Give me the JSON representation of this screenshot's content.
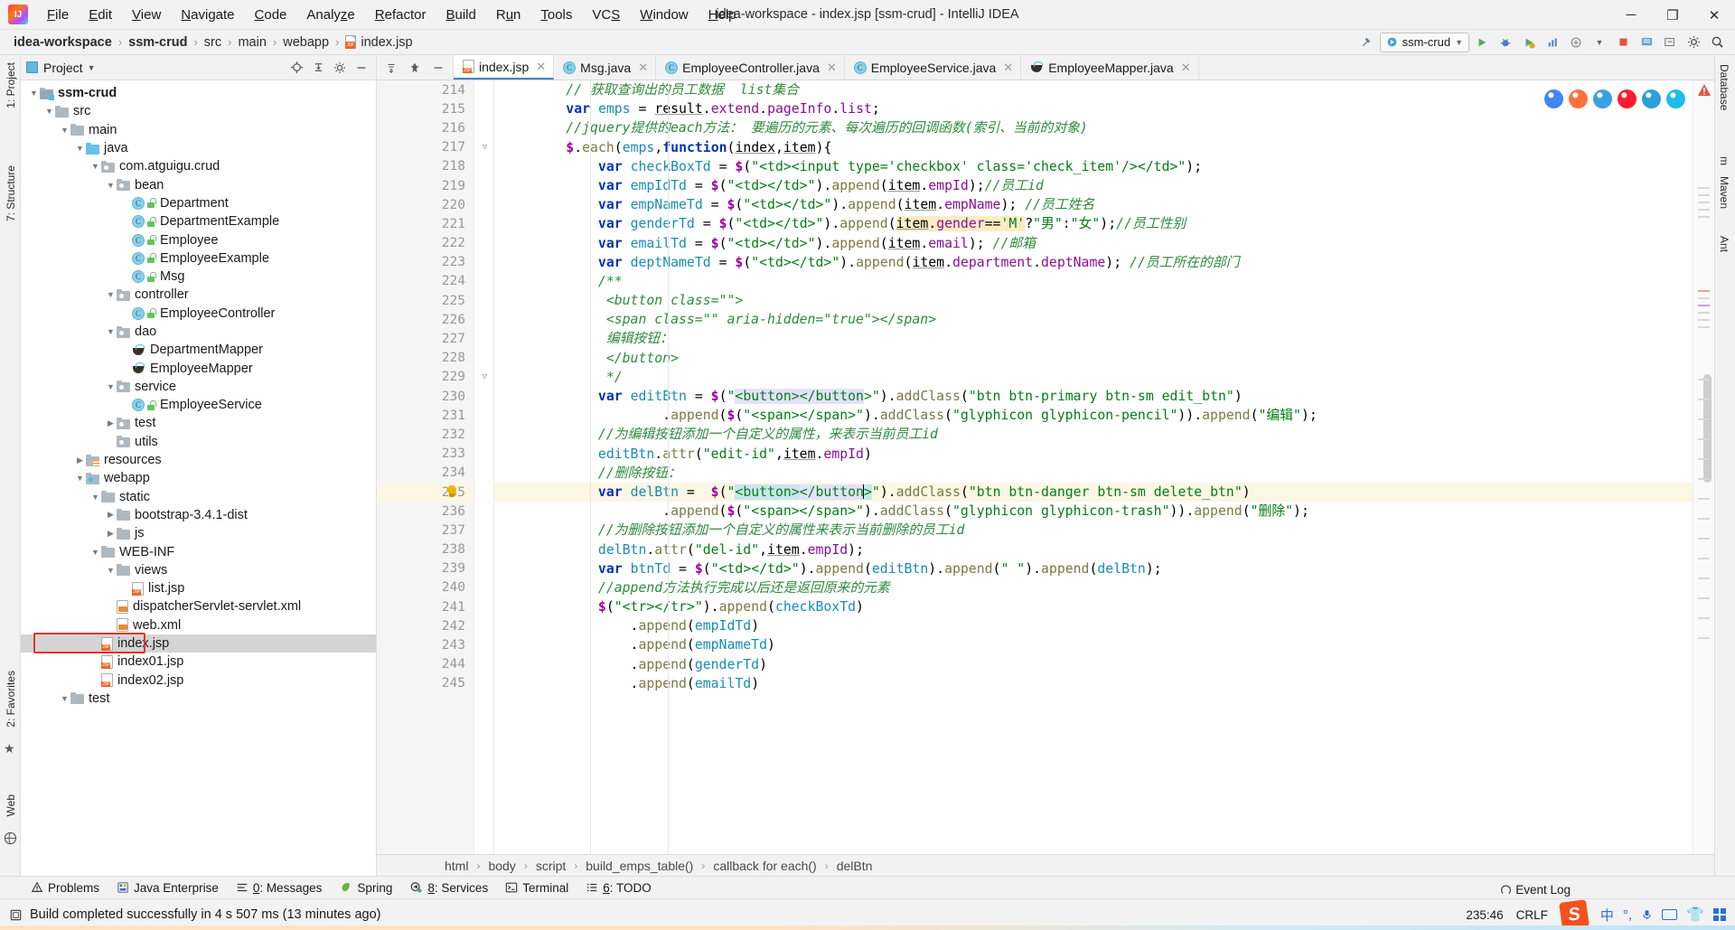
{
  "window": {
    "title": "idea-workspace - index.jsp [ssm-crud] - IntelliJ IDEA",
    "minimize": "─",
    "maximize": "❐",
    "close": "✕"
  },
  "menubar": [
    {
      "label": "File",
      "mnemonic": "F"
    },
    {
      "label": "Edit",
      "mnemonic": "E"
    },
    {
      "label": "View",
      "mnemonic": "V"
    },
    {
      "label": "Navigate",
      "mnemonic": "N"
    },
    {
      "label": "Code",
      "mnemonic": "C"
    },
    {
      "label": "Analyze",
      "mnemonic": "z"
    },
    {
      "label": "Refactor",
      "mnemonic": "R"
    },
    {
      "label": "Build",
      "mnemonic": "B"
    },
    {
      "label": "Run",
      "mnemonic": "u"
    },
    {
      "label": "Tools",
      "mnemonic": "T"
    },
    {
      "label": "VCS",
      "mnemonic": "S"
    },
    {
      "label": "Window",
      "mnemonic": "W"
    },
    {
      "label": "Help",
      "mnemonic": "H"
    }
  ],
  "breadcrumb": [
    {
      "label": "idea-workspace",
      "bold": true
    },
    {
      "label": "ssm-crud",
      "bold": true
    },
    {
      "label": "src",
      "bold": false
    },
    {
      "label": "main",
      "bold": false
    },
    {
      "label": "webapp",
      "bold": false
    },
    {
      "label": "index.jsp",
      "bold": false,
      "icon": "jsp-file-icon"
    }
  ],
  "nav_right": {
    "build_icon": "hammer-icon",
    "run_config": "ssm-crud",
    "run_icon": "run-icon",
    "debug_icon": "debug-icon",
    "coverage_icon": "coverage-icon",
    "profile_icon": "profile-icon",
    "attach_icon": "attach-icon",
    "stop_icon": "stop-icon",
    "update_icon": "update-icon",
    "settings_icon": "gear-icon",
    "search_icon": "search-icon"
  },
  "left_strips": [
    {
      "label": "1: Project"
    },
    {
      "label": "7: Structure"
    },
    {
      "label": "2: Favorites"
    },
    {
      "label": "Web"
    }
  ],
  "right_strips": [
    {
      "label": "Database"
    },
    {
      "label": "m"
    },
    {
      "label": "Maven"
    },
    {
      "label": "Ant"
    }
  ],
  "project_panel": {
    "title": "Project",
    "chevron": "▼",
    "tools": [
      "target-icon",
      "collapse-icon",
      "gear-icon",
      "hide-icon"
    ],
    "tree": [
      {
        "depth": 0,
        "label": "ssm-crud",
        "arrow": "down",
        "icon": "module-folder",
        "bold": true
      },
      {
        "depth": 1,
        "label": "src",
        "arrow": "down",
        "icon": "folder"
      },
      {
        "depth": 2,
        "label": "main",
        "arrow": "down",
        "icon": "folder"
      },
      {
        "depth": 3,
        "label": "java",
        "arrow": "down",
        "icon": "source-folder"
      },
      {
        "depth": 4,
        "label": "com.atguigu.crud",
        "arrow": "down",
        "icon": "package-folder"
      },
      {
        "depth": 5,
        "label": "bean",
        "arrow": "down",
        "icon": "package-folder"
      },
      {
        "depth": 6,
        "label": "Department",
        "arrow": "none",
        "icon": "java-class"
      },
      {
        "depth": 6,
        "label": "DepartmentExample",
        "arrow": "none",
        "icon": "java-class"
      },
      {
        "depth": 6,
        "label": "Employee",
        "arrow": "none",
        "icon": "java-class"
      },
      {
        "depth": 6,
        "label": "EmployeeExample",
        "arrow": "none",
        "icon": "java-class"
      },
      {
        "depth": 6,
        "label": "Msg",
        "arrow": "none",
        "icon": "java-class"
      },
      {
        "depth": 5,
        "label": "controller",
        "arrow": "down",
        "icon": "package-folder"
      },
      {
        "depth": 6,
        "label": "EmployeeController",
        "arrow": "none",
        "icon": "java-class"
      },
      {
        "depth": 5,
        "label": "dao",
        "arrow": "down",
        "icon": "package-folder"
      },
      {
        "depth": 6,
        "label": "DepartmentMapper",
        "arrow": "none",
        "icon": "mybatis-mapper"
      },
      {
        "depth": 6,
        "label": "EmployeeMapper",
        "arrow": "none",
        "icon": "mybatis-mapper"
      },
      {
        "depth": 5,
        "label": "service",
        "arrow": "down",
        "icon": "package-folder"
      },
      {
        "depth": 6,
        "label": "EmployeeService",
        "arrow": "none",
        "icon": "java-class"
      },
      {
        "depth": 5,
        "label": "test",
        "arrow": "right",
        "icon": "package-folder"
      },
      {
        "depth": 5,
        "label": "utils",
        "arrow": "none",
        "icon": "package-folder"
      },
      {
        "depth": 3,
        "label": "resources",
        "arrow": "right",
        "icon": "resources-folder"
      },
      {
        "depth": 3,
        "label": "webapp",
        "arrow": "down",
        "icon": "webapp-folder"
      },
      {
        "depth": 4,
        "label": "static",
        "arrow": "down",
        "icon": "folder"
      },
      {
        "depth": 5,
        "label": "bootstrap-3.4.1-dist",
        "arrow": "right",
        "icon": "folder"
      },
      {
        "depth": 5,
        "label": "js",
        "arrow": "right",
        "icon": "folder"
      },
      {
        "depth": 4,
        "label": "WEB-INF",
        "arrow": "down",
        "icon": "folder"
      },
      {
        "depth": 5,
        "label": "views",
        "arrow": "down",
        "icon": "folder"
      },
      {
        "depth": 6,
        "label": "list.jsp",
        "arrow": "none",
        "icon": "jsp-file"
      },
      {
        "depth": 5,
        "label": "dispatcherServlet-servlet.xml",
        "arrow": "none",
        "icon": "xml-file"
      },
      {
        "depth": 5,
        "label": "web.xml",
        "arrow": "none",
        "icon": "xml-file"
      },
      {
        "depth": 4,
        "label": "index.jsp",
        "arrow": "none",
        "icon": "jsp-file",
        "selected": true,
        "annotated": true
      },
      {
        "depth": 4,
        "label": "index01.jsp",
        "arrow": "none",
        "icon": "jsp-file"
      },
      {
        "depth": 4,
        "label": "index02.jsp",
        "arrow": "none",
        "icon": "jsp-file"
      },
      {
        "depth": 2,
        "label": "test",
        "arrow": "down",
        "icon": "folder"
      }
    ]
  },
  "editor_tabs": [
    {
      "label": "index.jsp",
      "icon": "jsp-file",
      "active": true
    },
    {
      "label": "Msg.java",
      "icon": "java-class",
      "active": false
    },
    {
      "label": "EmployeeController.java",
      "icon": "java-class",
      "active": false
    },
    {
      "label": "EmployeeService.java",
      "icon": "java-class",
      "active": false
    },
    {
      "label": "EmployeeMapper.java",
      "icon": "mybatis-mapper",
      "active": false
    }
  ],
  "editor": {
    "first_line": 214,
    "current_line": 235,
    "lines": [
      {
        "n": 214,
        "html": "        <span class=\"cm\">// 获取查询出的员工数据  list集合</span>"
      },
      {
        "n": 215,
        "html": "        <span class=\"kw\">var</span> <span class=\"loc\">emps</span> = <span class=\"param\">result</span><span class=\"pl\">.</span><span class=\"prop\">extend</span><span class=\"pl\">.</span><span class=\"prop\">pageInfo</span><span class=\"pl\">.</span><span class=\"prop\">list</span><span class=\"pl\">;</span>"
      },
      {
        "n": 216,
        "html": "        <span class=\"cm\">//jquery提供的each方法： 要遍历的元素、每次遍历的回调函数(索引、当前的对象)</span>"
      },
      {
        "n": 217,
        "html": "        <span class=\"dollar\">$</span><span class=\"pl\">.</span><span class=\"fn\">each</span><span class=\"pl\">(</span><span class=\"loc\">emps</span><span class=\"pl\">,</span><span class=\"kw\">function</span><span class=\"pl\">(</span><span class=\"param\">index</span><span class=\"pl\">,</span><span class=\"param\">item</span><span class=\"pl\">){</span>"
      },
      {
        "n": 218,
        "html": "            <span class=\"kw\">var</span> <span class=\"loc\">checkBoxTd</span> = <span class=\"dollar\">$</span>(<span class=\"str\">\"&lt;td&gt;&lt;input type='checkbox' class='check_item'/&gt;&lt;/td&gt;\"</span>);"
      },
      {
        "n": 219,
        "html": "            <span class=\"kw\">var</span> <span class=\"loc\">empIdTd</span> = <span class=\"dollar\">$</span>(<span class=\"str\">\"&lt;td&gt;&lt;/td&gt;\"</span>).<span class=\"fn\">append</span>(<span class=\"param\">item</span>.<span class=\"prop\">empId</span>);<span class=\"cm\">//员工id</span>"
      },
      {
        "n": 220,
        "html": "            <span class=\"kw\">var</span> <span class=\"loc\">empNameTd</span> = <span class=\"dollar\">$</span>(<span class=\"str\">\"&lt;td&gt;&lt;/td&gt;\"</span>).<span class=\"fn\">append</span>(<span class=\"param\">item</span>.<span class=\"prop\">empName</span>); <span class=\"cm\">//员工姓名</span>"
      },
      {
        "n": 221,
        "html": "            <span class=\"kw\">var</span> <span class=\"loc\">genderTd</span> = <span class=\"dollar\">$</span>(<span class=\"str\">\"&lt;td&gt;&lt;/td&gt;\"</span>).<span class=\"fn\">append</span>(<span class=\"warn-hl\"><span class=\"param\">item</span>.<span class=\"prop\">gender</span>==<span class=\"str\">'M'</span></span>?<span class=\"str\">\"男\"</span>:<span class=\"str\">\"女\"</span>);<span class=\"cm\">//员工性别</span>"
      },
      {
        "n": 222,
        "html": "            <span class=\"kw\">var</span> <span class=\"loc\">emailTd</span> = <span class=\"dollar\">$</span>(<span class=\"str\">\"&lt;td&gt;&lt;/td&gt;\"</span>).<span class=\"fn\">append</span>(<span class=\"param\">item</span>.<span class=\"prop\">email</span>); <span class=\"cm\">//邮箱</span>"
      },
      {
        "n": 223,
        "html": "            <span class=\"kw\">var</span> <span class=\"loc\">deptNameTd</span> = <span class=\"dollar\">$</span>(<span class=\"str\">\"&lt;td&gt;&lt;/td&gt;\"</span>).<span class=\"fn\">append</span>(<span class=\"param\">item</span>.<span class=\"prop\">department</span>.<span class=\"prop\">deptName</span>); <span class=\"cm\">//员工所在的部门</span>"
      },
      {
        "n": 224,
        "html": "            <span class=\"cm\">/**</span>"
      },
      {
        "n": 225,
        "html": "             <span class=\"cm\">&lt;button class=\"\"&gt;</span>"
      },
      {
        "n": 226,
        "html": "             <span class=\"cm\">&lt;span class=\"\" aria-hidden=\"true\"&gt;&lt;/span&gt;</span>"
      },
      {
        "n": 227,
        "html": "             <span class=\"cm\">编辑按钮：</span>"
      },
      {
        "n": 228,
        "html": "             <span class=\"cm\">&lt;/button&gt;</span>"
      },
      {
        "n": 229,
        "html": "             <span class=\"cm\">*/</span>"
      },
      {
        "n": 230,
        "html": "            <span class=\"kw\">var</span> <span class=\"loc\">editBtn</span> = <span class=\"dollar\">$</span>(<span class=\"str\">\"<span class=\"sel-b\">&lt;button&gt;&lt;/button</span>&gt;\"</span>).<span class=\"fn\">addClass</span>(<span class=\"str\">\"btn btn-primary btn-sm edit_btn\"</span>)"
      },
      {
        "n": 231,
        "html": "                    .<span class=\"fn\">append</span>(<span class=\"dollar\">$</span>(<span class=\"str\">\"&lt;span&gt;&lt;/span&gt;\"</span>).<span class=\"fn\">addClass</span>(<span class=\"str\">\"glyphicon glyphicon-pencil\"</span>)).<span class=\"fn\">append</span>(<span class=\"str\">\"编辑\"</span>);"
      },
      {
        "n": 232,
        "html": "            <span class=\"cm\">//为编辑按钮添加一个自定义的属性，来表示当前员工id</span>"
      },
      {
        "n": 233,
        "html": "            <span class=\"loc\">editBtn</span>.<span class=\"fn\">attr</span>(<span class=\"str\">\"edit-id\"</span>,<span class=\"param\">item</span>.<span class=\"prop\">empId</span>)"
      },
      {
        "n": 234,
        "html": "            <span class=\"cm\">//删除按钮：</span>"
      },
      {
        "n": 235,
        "html": "            <span class=\"kw\">var</span> <span class=\"loc\">delBtn</span> =  <span class=\"dollar\">$</span>(<span class=\"str\">\"<span class=\"sel-hl\">&lt;button&gt;</span><span class=\"sel-b\">&lt;/button</span><span class=\"sel-hl\">&gt;</span>\"</span>).<span class=\"fn\">addClass</span>(<span class=\"str\">\"btn btn-danger btn-sm delete_btn\"</span>)",
        "current": true
      },
      {
        "n": 236,
        "html": "                    .<span class=\"fn\">append</span>(<span class=\"dollar\">$</span>(<span class=\"str\">\"&lt;span&gt;&lt;/span&gt;\"</span>).<span class=\"fn\">addClass</span>(<span class=\"str\">\"glyphicon glyphicon-trash\"</span>)).<span class=\"fn\">append</span>(<span class=\"str\">\"删除\"</span>);"
      },
      {
        "n": 237,
        "html": "            <span class=\"cm\">//为删除按钮添加一个自定义的属性来表示当前删除的员工id</span>"
      },
      {
        "n": 238,
        "html": "            <span class=\"loc\">delBtn</span>.<span class=\"fn\">attr</span>(<span class=\"str\">\"del-id\"</span>,<span class=\"param\">item</span>.<span class=\"prop\">empId</span>);"
      },
      {
        "n": 239,
        "html": "            <span class=\"kw\">var</span> <span class=\"loc\">btnTd</span> = <span class=\"dollar\">$</span>(<span class=\"str\">\"&lt;td&gt;&lt;/td&gt;\"</span>).<span class=\"fn\">append</span>(<span class=\"loc\">editBtn</span>).<span class=\"fn\">append</span>(<span class=\"str\">\" \"</span>).<span class=\"fn\">append</span>(<span class=\"loc\">delBtn</span>);"
      },
      {
        "n": 240,
        "html": "            <span class=\"cm\">//append方法执行完成以后还是返回原来的元素</span>"
      },
      {
        "n": 241,
        "html": "            <span class=\"dollar\">$</span>(<span class=\"str\">\"&lt;tr&gt;&lt;/tr&gt;\"</span>).<span class=\"fn\">append</span>(<span class=\"loc\">checkBoxTd</span>)"
      },
      {
        "n": 242,
        "html": "                .<span class=\"fn\">append</span>(<span class=\"loc\">empIdTd</span>)"
      },
      {
        "n": 243,
        "html": "                .<span class=\"fn\">append</span>(<span class=\"loc\">empNameTd</span>)"
      },
      {
        "n": 244,
        "html": "                .<span class=\"fn\">append</span>(<span class=\"loc\">genderTd</span>)"
      },
      {
        "n": 245,
        "html": "                .<span class=\"fn\">append</span>(<span class=\"loc\">emailTd</span>)"
      }
    ],
    "fold_lines": [
      217,
      229
    ],
    "bulb_line": 235
  },
  "editor_breadcrumbs": [
    "html",
    "body",
    "script",
    "build_emps_table()",
    "callback for each()",
    "delBtn"
  ],
  "browser_icons": [
    {
      "name": "chrome-icon",
      "color": "#4285f4"
    },
    {
      "name": "firefox-icon",
      "color": "#ff7139"
    },
    {
      "name": "safari-icon",
      "color": "#3aa2e0"
    },
    {
      "name": "opera-icon",
      "color": "#ff1b2d"
    },
    {
      "name": "edge-icon",
      "color": "#2d9fd9"
    },
    {
      "name": "ie-icon",
      "color": "#1ebbee"
    }
  ],
  "tool_windows": [
    {
      "label": "Problems",
      "icon": "warning-icon",
      "mnemonic": ""
    },
    {
      "label": "Java Enterprise",
      "icon": "enterprise-icon",
      "mnemonic": ""
    },
    {
      "label": "0: Messages",
      "icon": "messages-icon",
      "mnemonic": "0"
    },
    {
      "label": "Spring",
      "icon": "spring-icon",
      "mnemonic": ""
    },
    {
      "label": "8: Services",
      "icon": "services-icon",
      "mnemonic": "8"
    },
    {
      "label": "Terminal",
      "icon": "terminal-icon",
      "mnemonic": ""
    },
    {
      "label": "6: TODO",
      "icon": "todo-icon",
      "mnemonic": "6"
    }
  ],
  "statusbar": {
    "message": "Build completed successfully in 4 s 507 ms (13 minutes ago)",
    "icon": "build-icon",
    "caret_position": "235:46",
    "line_separator": "CRLF",
    "event_log": "Event Log",
    "ime": {
      "sogou": "S",
      "lang": "中",
      "punct": "°,",
      "mic": "mic-icon",
      "keyboard": "keyboard-icon",
      "skin": "skin-icon",
      "apps": "apps-icon"
    }
  },
  "colors": {
    "accent": "#4083c9",
    "annotation": "#e8332a",
    "keyword": "#0033b3",
    "string": "#067d17",
    "comment": "#2e8b3c",
    "property": "#871094",
    "current_line": "#fcf6e4"
  }
}
